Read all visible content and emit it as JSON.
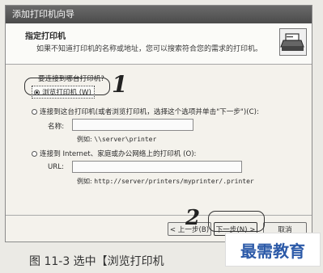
{
  "dialog": {
    "title": "添加打印机向导",
    "header_title": "指定打印机",
    "header_desc": "如果不知道打印机的名称或地址，您可以搜索符合您的需求的打印机。",
    "question": "要连接到哪台打印机?",
    "option_browse": "浏览打印机 (W)",
    "option_connect": "连接到这台打印机(或者浏览打印机，选择这个选项并单击\"下一步\")(C):",
    "name_label": "名称:",
    "name_value": "",
    "name_example_prefix": "例如:",
    "name_example": "\\\\server\\printer",
    "option_internet": "连接到 Internet、家庭或办公网络上的打印机 (O):",
    "url_label": "URL:",
    "url_value": "",
    "url_example_prefix": "例如:",
    "url_example": "http://server/printers/myprinter/.printer",
    "btn_back": "< 上一步(B)",
    "btn_next": "下一步(N) >",
    "btn_cancel": "取消",
    "selected_option": "browse"
  },
  "annotations": {
    "step1": "1",
    "step2": "2"
  },
  "caption": "图 11-3   选中【浏览打印机",
  "watermark": "最需教育"
}
